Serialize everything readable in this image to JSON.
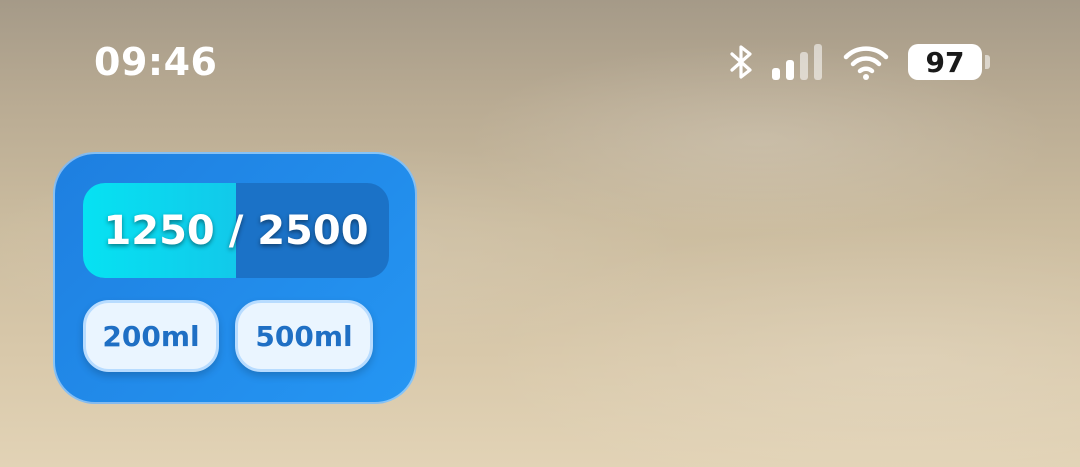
{
  "status_bar": {
    "time": "09:46",
    "battery_percent": "97",
    "icons": [
      "bluetooth-icon",
      "signal-icon",
      "wifi-icon",
      "battery-icon"
    ],
    "signal_bars_active": 2,
    "signal_bars_total": 4
  },
  "widget": {
    "progress": {
      "text": "1250 / 2500",
      "current": 1250,
      "goal": 2500,
      "fraction": 0.5
    },
    "buttons": [
      {
        "label": "200ml"
      },
      {
        "label": "500ml"
      }
    ],
    "colors": {
      "background": "#2596f3",
      "progress_track": "#1b72c7",
      "progress_fill": "#06e2f2",
      "button_text": "#1f6fc4"
    }
  }
}
